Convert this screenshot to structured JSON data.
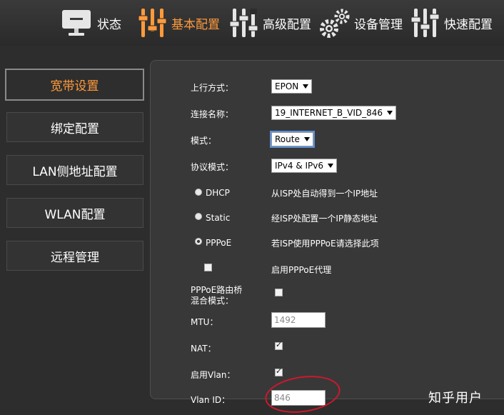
{
  "nav": {
    "items": [
      {
        "label": "状态",
        "icon": "monitor-icon"
      },
      {
        "label": "基本配置",
        "icon": "sliders-icon",
        "active": true
      },
      {
        "label": "高级配置",
        "icon": "advanced-sliders-icon"
      },
      {
        "label": "设备管理",
        "icon": "gears-icon"
      },
      {
        "label": "快速配置",
        "icon": "quick-sliders-icon"
      }
    ],
    "active_color": "#ff9a3c"
  },
  "sidebar": {
    "items": [
      {
        "label": "宽带设置",
        "active": true
      },
      {
        "label": "绑定配置"
      },
      {
        "label": "LAN侧地址配置"
      },
      {
        "label": "WLAN配置"
      },
      {
        "label": "远程管理"
      }
    ]
  },
  "form": {
    "uplink": {
      "label": "上行方式：",
      "value": "EPON"
    },
    "connection_name": {
      "label": "连接名称：",
      "value": "19_INTERNET_B_VID_846"
    },
    "mode": {
      "label": "模式：",
      "value": "Route"
    },
    "protocol": {
      "label": "协议模式：",
      "value": "IPv4 & IPv6"
    },
    "dhcp": {
      "label": "DHCP",
      "desc": "从ISP处自动得到一个IP地址",
      "checked": false
    },
    "static": {
      "label": "Static",
      "desc": "经ISP处配置一个IP静态地址",
      "checked": false
    },
    "pppoe": {
      "label": "PPPoE",
      "desc": "若ISP使用PPPoE请选择此项",
      "checked": true
    },
    "pppoe_proxy": {
      "desc": "启用PPPoE代理",
      "checked": false
    },
    "pppoe_bridge": {
      "label_line1": "PPPoE路由桥",
      "label_line2": "混合模式：",
      "checked": false
    },
    "mtu": {
      "label": "MTU：",
      "value": "1492"
    },
    "nat": {
      "label": "NAT：",
      "checked": true
    },
    "vlan_enable": {
      "label": "启用Vlan：",
      "checked": true
    },
    "vlan_id": {
      "label": "Vlan ID：",
      "value": "846"
    }
  },
  "watermark": "知乎用户",
  "annotation_color": "#d0182b"
}
